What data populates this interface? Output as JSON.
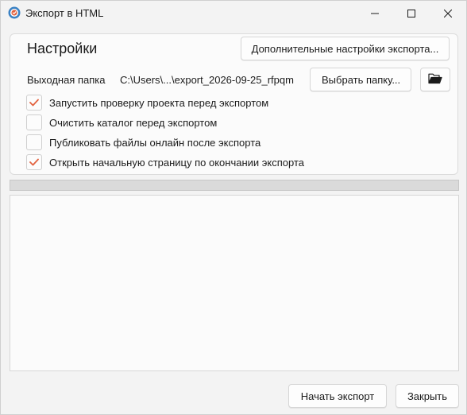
{
  "window": {
    "title": "Экспорт в HTML",
    "app_icon": "app-export-icon",
    "controls": [
      "minimize-icon",
      "maximize-icon",
      "close-icon"
    ]
  },
  "settings": {
    "title": "Настройки",
    "advanced_button_label": "Дополнительные настройки экспорта...",
    "output_folder_label": "Выходная папка",
    "output_folder_path": "C:\\Users\\...\\export_2026-09-25_rfpqm",
    "choose_folder_button_label": "Выбрать папку...",
    "open_folder_icon": "folder-open-icon",
    "options": [
      {
        "label": "Запустить проверку проекта перед экспортом",
        "checked": true
      },
      {
        "label": "Очистить каталог перед экспортом",
        "checked": false
      },
      {
        "label": "Публиковать файлы онлайн после экспорта",
        "checked": false
      },
      {
        "label": "Открыть начальную страницу по окончании экспорта",
        "checked": true
      }
    ]
  },
  "progress": {
    "value": 0
  },
  "log": {
    "text": ""
  },
  "footer": {
    "start_button_label": "Начать экспорт",
    "close_button_label": "Закрыть"
  },
  "colors": {
    "checkmark": "#e2623f",
    "accent": "#6b9bd1"
  }
}
